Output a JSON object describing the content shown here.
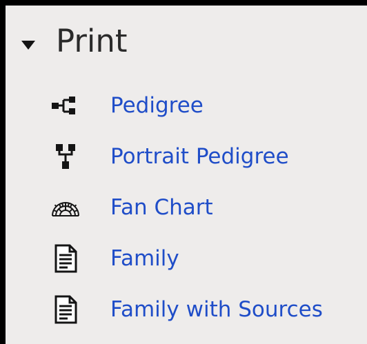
{
  "section": {
    "title": "Print",
    "expanded": true,
    "items": [
      {
        "label": "Pedigree",
        "icon": "pedigree-chart-icon"
      },
      {
        "label": "Portrait Pedigree",
        "icon": "portrait-pedigree-icon"
      },
      {
        "label": "Fan Chart",
        "icon": "fan-chart-icon"
      },
      {
        "label": "Family",
        "icon": "document-icon"
      },
      {
        "label": "Family with Sources",
        "icon": "document-icon"
      }
    ]
  },
  "colors": {
    "panel_background": "#eeeceb",
    "frame": "#000000",
    "link": "#1f4dc8",
    "heading": "#2a2a2a",
    "icon": "#141414"
  }
}
